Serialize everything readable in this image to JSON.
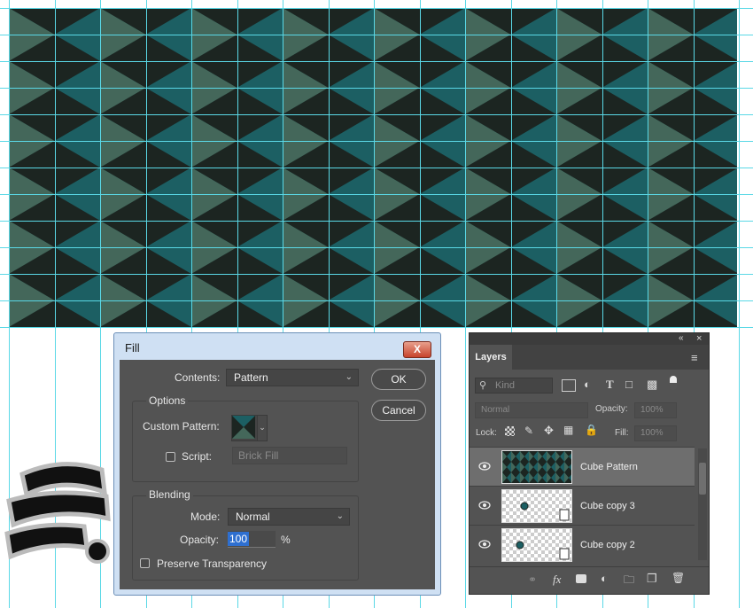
{
  "fill_dialog": {
    "title": "Fill",
    "close_label": "X",
    "contents_label": "Contents:",
    "contents_value": "Pattern",
    "ok_label": "OK",
    "cancel_label": "Cancel",
    "options_title": "Options",
    "custom_pattern_label": "Custom Pattern:",
    "script_label": "Script:",
    "script_value": "Brick Fill",
    "blending_title": "Blending",
    "mode_label": "Mode:",
    "mode_value": "Normal",
    "opacity_label": "Opacity:",
    "opacity_value": "100",
    "opacity_unit": "%",
    "preserve_label": "Preserve Transparency"
  },
  "layers_panel": {
    "tab_label": "Layers",
    "collapse_icon": "double-chevron-left-icon",
    "close_icon": "close-icon",
    "menu_icon": "hamburger-menu-icon",
    "filter_placeholder": "Kind",
    "blend_mode": "Normal",
    "opacity_label": "Opacity:",
    "opacity_value": "100%",
    "lock_label": "Lock:",
    "fill_label": "Fill:",
    "fill_value": "100%",
    "layers": [
      {
        "name": "Cube Pattern",
        "selected": true
      },
      {
        "name": "Cube copy 3",
        "selected": false
      },
      {
        "name": "Cube copy 2",
        "selected": false
      }
    ],
    "bottom_icons": [
      "link-icon",
      "fx-icon",
      "mask-icon",
      "adjustment-icon",
      "folder-icon",
      "new-layer-icon",
      "trash-icon"
    ]
  },
  "colors": {
    "guide": "#5ad8e6",
    "tile_dark": "#1c2521",
    "tile_teal": "#1c5f63",
    "tile_sage": "#44675a",
    "panel_bg": "#535353",
    "accent_selection": "#2e6fd0"
  }
}
